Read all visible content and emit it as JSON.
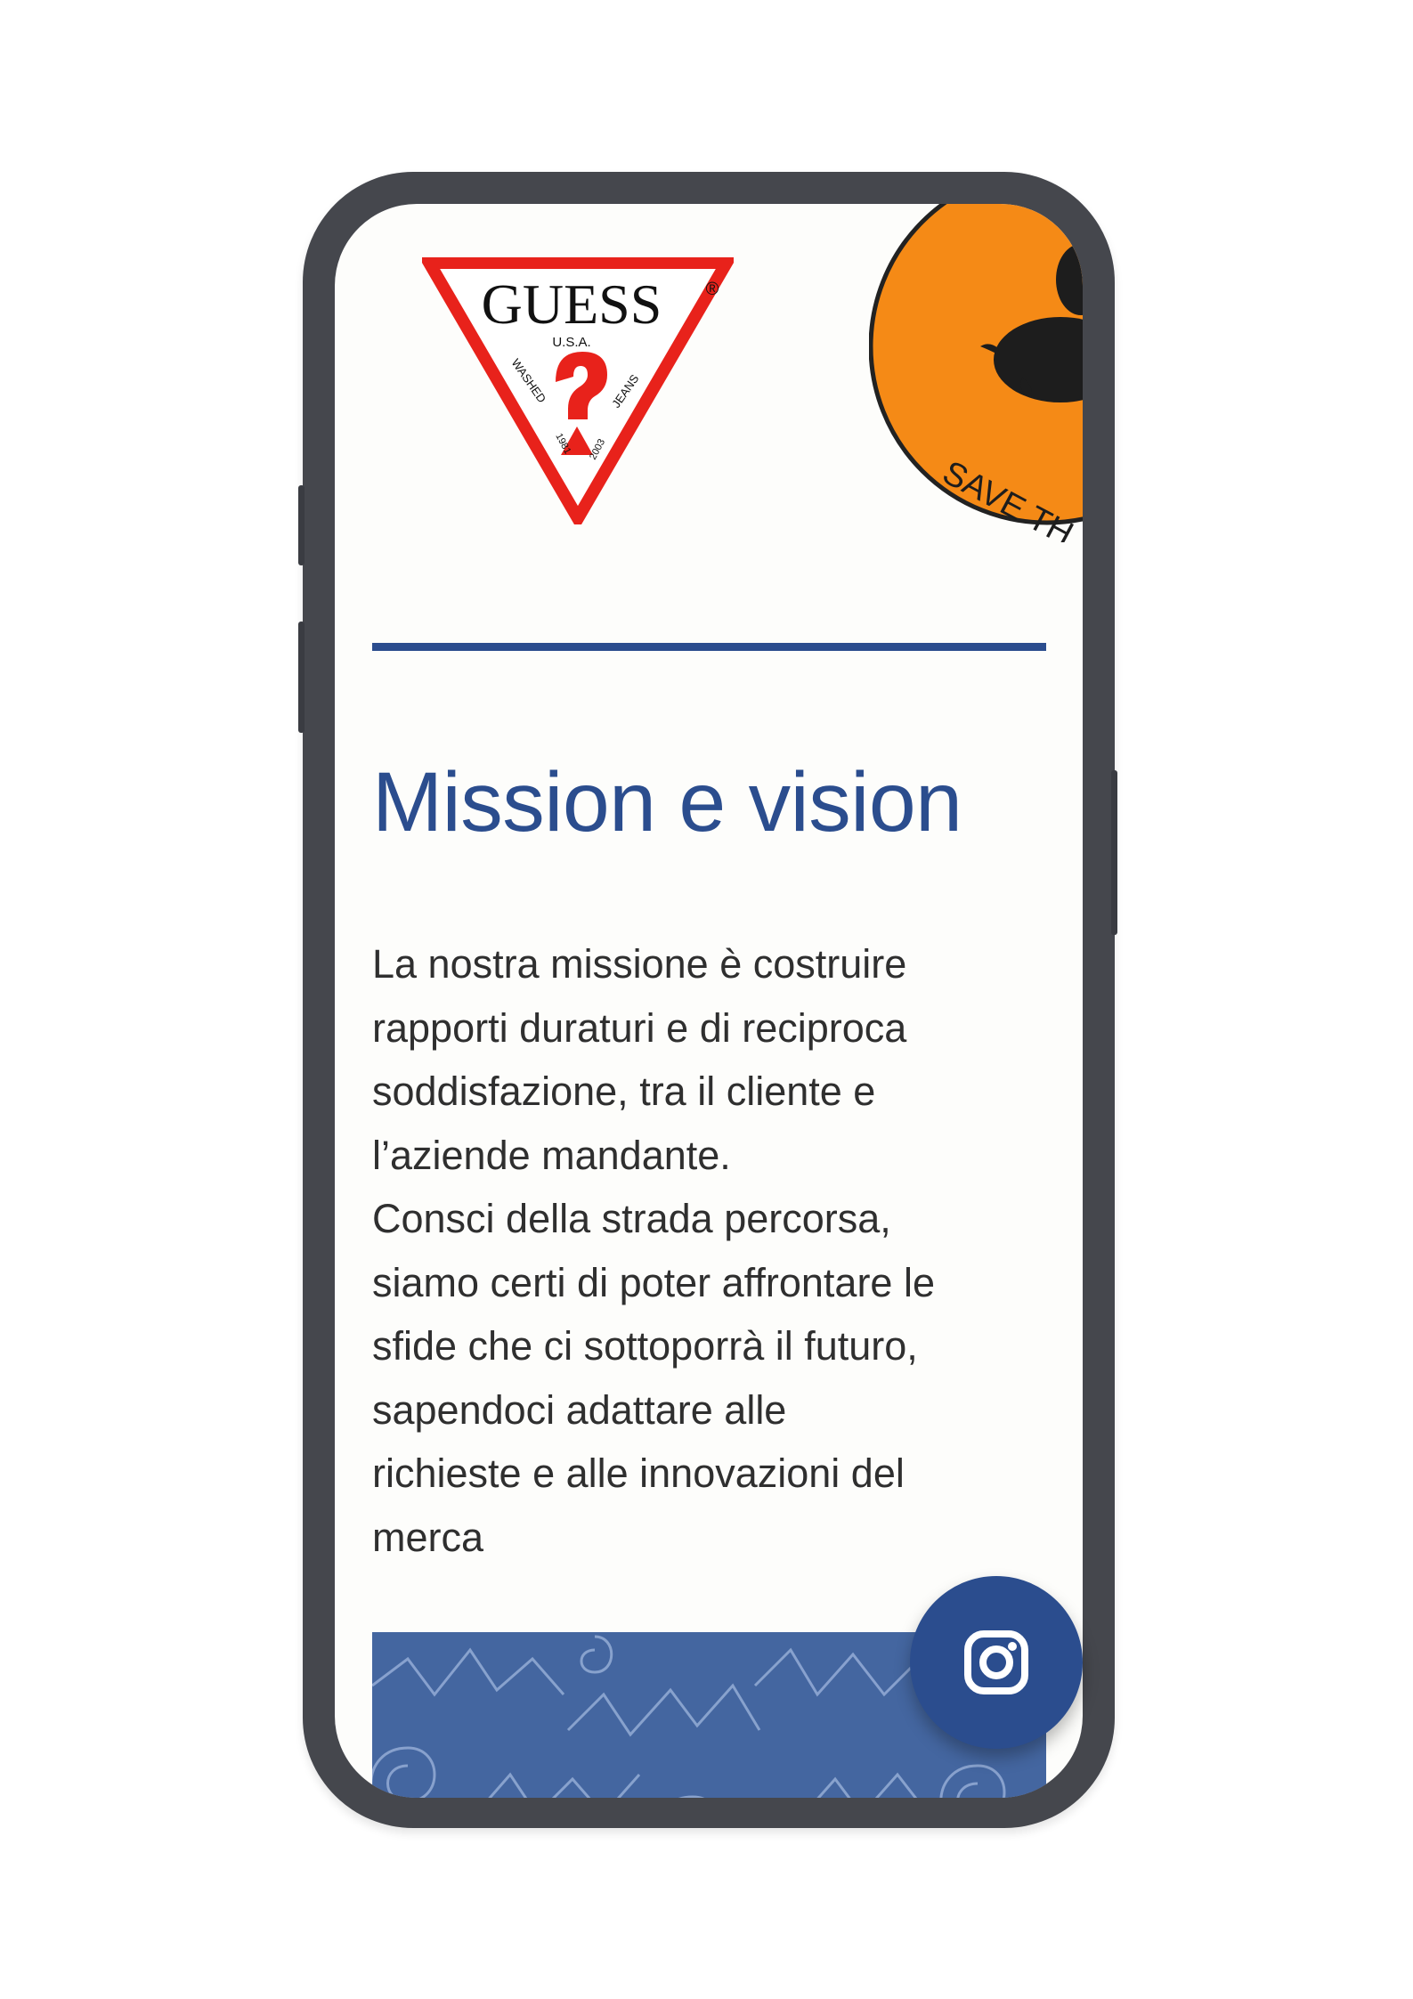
{
  "brand_logos": [
    {
      "name": "GUESS",
      "sub": "U.S.A.",
      "left_text": "WASHED",
      "right_text": "JEANS",
      "year_left": "1981",
      "year_right": "2003",
      "colors": {
        "outline": "#e8221b",
        "text": "#111111"
      }
    },
    {
      "name": "Save The Duck",
      "visible_text": "SAVE TH",
      "colors": {
        "fill": "#f58a16",
        "stroke": "#222222"
      }
    }
  ],
  "section": {
    "title": "Mission e vision",
    "lines": [
      "La nostra missione è costruire",
      "rapporti duraturi e di reciproca",
      "soddisfazione, tra il cliente e",
      "l’aziende mandante.",
      "Consci della strada percorsa,",
      "siamo certi di poter affrontare le",
      "sfide che ci sottoporrà il futuro,",
      "sapendoci adattare alle",
      "richieste e alle innovazioni del",
      "merca"
    ]
  },
  "fab": {
    "icon": "instagram-icon"
  },
  "colors": {
    "accent": "#2b4d8e",
    "text": "#2f2f2f",
    "frame": "#45474d",
    "screen": "#fdfdfb"
  }
}
